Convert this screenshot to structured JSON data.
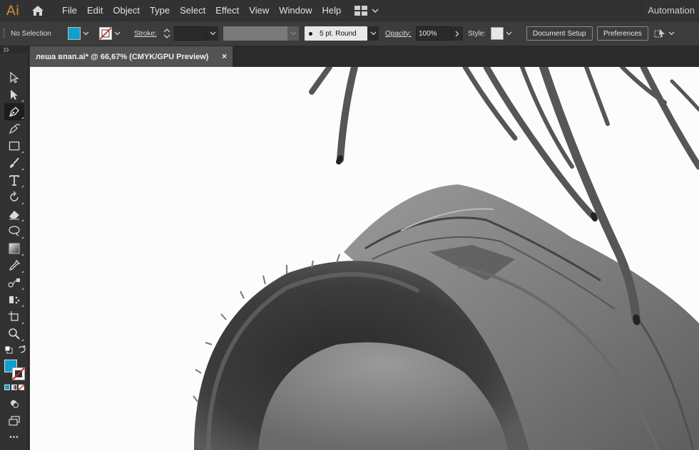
{
  "app": {
    "logo_text": "Ai"
  },
  "menu": [
    "File",
    "Edit",
    "Object",
    "Type",
    "Select",
    "Effect",
    "View",
    "Window",
    "Help"
  ],
  "workspace": {
    "label": "Automation"
  },
  "control": {
    "selection_label": "No Selection",
    "fill_color": "#0fa0cc",
    "stroke_label": "Stroke:",
    "brush_label": "5 pt. Round",
    "opacity_label": "Opacity:",
    "opacity_value": "100%",
    "style_label": "Style:",
    "document_setup_label": "Document Setup",
    "preferences_label": "Preferences"
  },
  "document": {
    "tab_title": "леша впап.ai* @ 66,67% (CMYK/GPU Preview)",
    "close_glyph": "×"
  },
  "toolbar": {
    "tools": [
      "selection-tool",
      "direct-selection-tool",
      "pen-tool",
      "curvature-tool",
      "rectangle-tool",
      "paintbrush-tool",
      "type-tool",
      "rotate-tool",
      "eraser-tool",
      "lasso-tool",
      "gradient-tool",
      "eyedropper-tool",
      "blend-tool",
      "symbol-sprayer-tool",
      "artboard-tool",
      "zoom-tool"
    ],
    "fill_color": "#0fa0cc",
    "more_label": "•••"
  }
}
